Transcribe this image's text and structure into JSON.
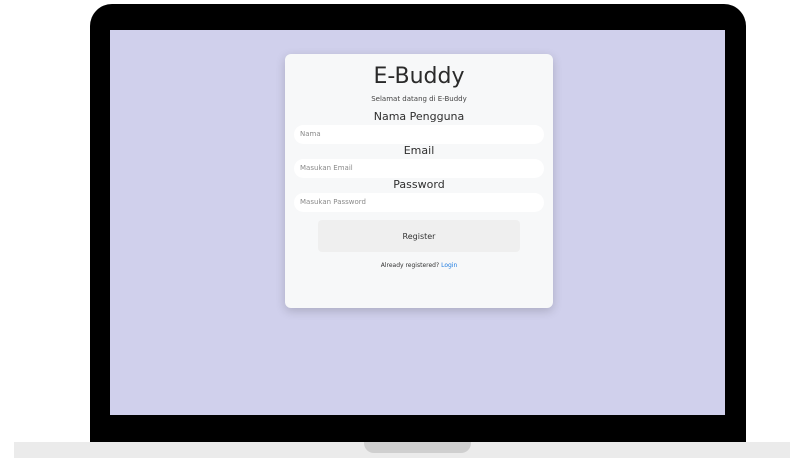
{
  "form": {
    "title": "E-Buddy",
    "subtitle": "Selamat datang di E-Buddy",
    "username_label": "Nama Pengguna",
    "username_placeholder": "Nama",
    "email_label": "Email",
    "email_placeholder": "Masukan Email",
    "password_label": "Password",
    "password_placeholder": "Masukan Password",
    "register_button": "Register",
    "footer_prompt": "Already registered?",
    "login_link": "Login"
  },
  "colors": {
    "screen_background": "#d0d0ec",
    "card_background": "#f7f8f9",
    "link": "#1e7be0"
  }
}
